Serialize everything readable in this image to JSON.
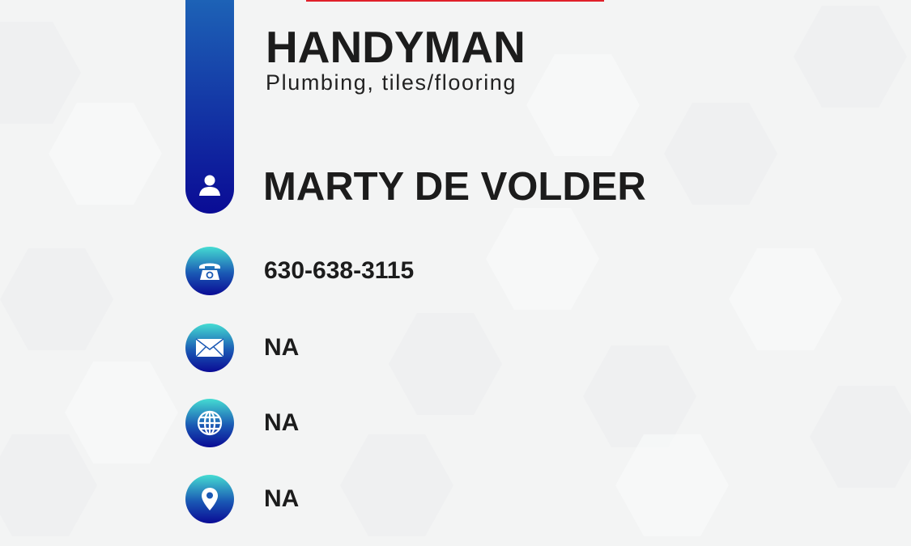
{
  "card": {
    "title": "HANDYMAN",
    "subtitle": "Plumbing, tiles/flooring",
    "name": "MARTY DE VOLDER",
    "contacts": [
      {
        "icon": "phone-icon",
        "value": "630-638-3115"
      },
      {
        "icon": "email-icon",
        "value": "NA"
      },
      {
        "icon": "globe-icon",
        "value": "NA"
      },
      {
        "icon": "location-pin-icon",
        "value": "NA"
      }
    ]
  },
  "colors": {
    "accent_top": "#45dcd2",
    "accent_bottom": "#0a0b95",
    "red": "#e0202a"
  }
}
